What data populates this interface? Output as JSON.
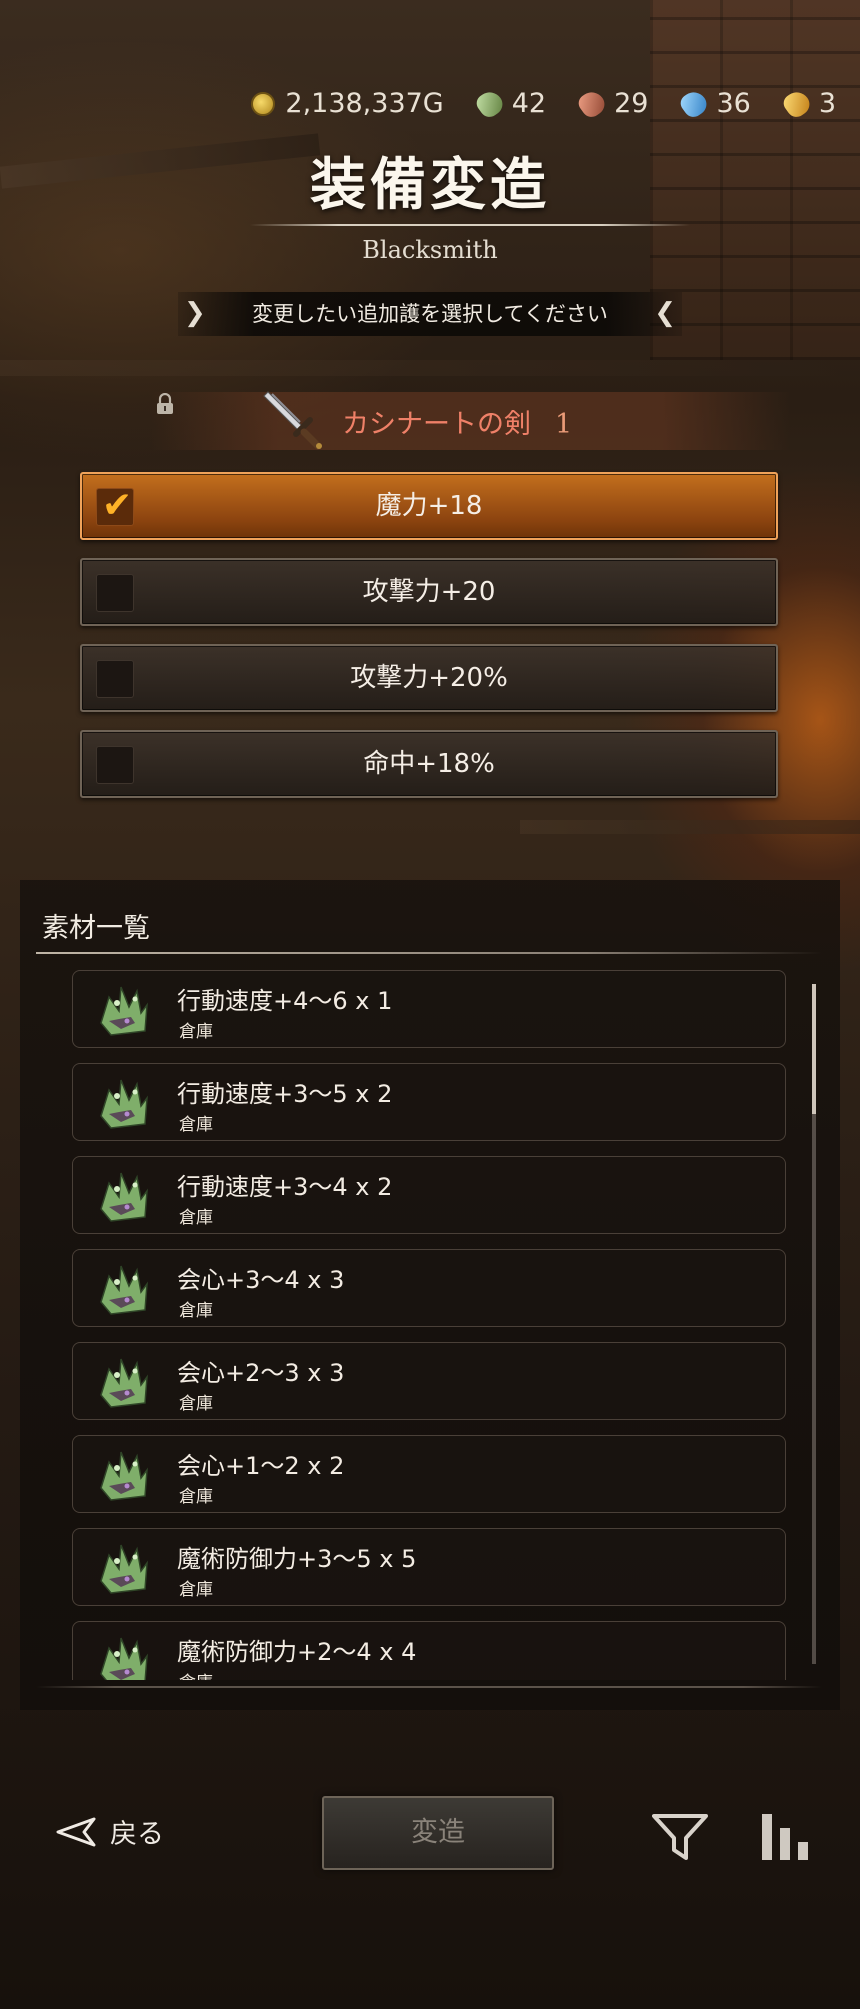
{
  "currencies": [
    {
      "icon": "gold-coin-icon",
      "value": "2,138,337G"
    },
    {
      "icon": "green-ore-icon",
      "value": "42"
    },
    {
      "icon": "red-ore-icon",
      "value": "29"
    },
    {
      "icon": "blue-ore-icon",
      "value": "36"
    },
    {
      "icon": "gold-ore-icon",
      "value": "3"
    }
  ],
  "header": {
    "title": "装備変造",
    "subtitle": "Blacksmith",
    "instruction": "変更したい追加護を選択してください"
  },
  "equipment": {
    "name": "カシナートの剣",
    "level": "1",
    "icon": "sword-icon",
    "locked": true
  },
  "options": [
    {
      "label": "魔力+18",
      "selected": true
    },
    {
      "label": "攻撃力+20",
      "selected": false
    },
    {
      "label": "攻撃力+20%",
      "selected": false
    },
    {
      "label": "命中+18%",
      "selected": false
    }
  ],
  "materials": {
    "title": "素材一覧",
    "items": [
      {
        "name": "行動速度+4～6 x 1",
        "location": "倉庫"
      },
      {
        "name": "行動速度+3～5 x 2",
        "location": "倉庫"
      },
      {
        "name": "行動速度+3～4 x 2",
        "location": "倉庫"
      },
      {
        "name": "会心+3～4 x 3",
        "location": "倉庫"
      },
      {
        "name": "会心+2～3 x 3",
        "location": "倉庫"
      },
      {
        "name": "会心+1～2 x 2",
        "location": "倉庫"
      },
      {
        "name": "魔術防御力+3～5 x 5",
        "location": "倉庫"
      },
      {
        "name": "魔術防御力+2～4 x 4",
        "location": "倉庫"
      }
    ]
  },
  "footer": {
    "back_label": "戻る",
    "convert_label": "変造",
    "convert_enabled": false
  },
  "colors": {
    "accent_orange": "#c36f1d",
    "check_color": "#ffb227",
    "equipment_name": "#ef8068"
  }
}
